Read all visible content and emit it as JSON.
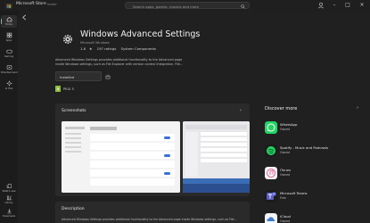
{
  "titlebar": {
    "title": "Microsoft Store",
    "badge": "Insider"
  },
  "search": {
    "placeholder": "Search apps, games, movies and more"
  },
  "sidebar": {
    "items": [
      {
        "label": "Home",
        "icon": "home-icon"
      },
      {
        "label": "Apps",
        "icon": "apps-icon"
      },
      {
        "label": "Gaming",
        "icon": "gaming-icon"
      },
      {
        "label": "Entertainment",
        "icon": "entertainment-icon"
      },
      {
        "label": "AI Hub",
        "icon": "ai-hub-icon"
      },
      {
        "label": "What's new",
        "icon": "whats-new-icon"
      },
      {
        "label": "Library",
        "icon": "library-icon"
      },
      {
        "label": "Downloads",
        "icon": "downloads-icon"
      }
    ]
  },
  "app": {
    "title": "Windows Advanced Settings",
    "publisher": "Microsoft Windows",
    "rating": "1.8",
    "ratings_count": "197 ratings",
    "category": "System Components",
    "description_line1": "Advanced Windows Settings provides additional functionality to the Advanced page",
    "description_line2": "inside Windows settings, such as File Explorer with version control integration. File...",
    "install_label": "Installed",
    "pegi": {
      "number": "3",
      "label": "PEGI 3"
    }
  },
  "screenshots": {
    "title": "Screenshots"
  },
  "description": {
    "title": "Description",
    "body": "Advanced Windows Settings provides additional functionality to the Advanced page inside Windows settings, such as File..."
  },
  "discover": {
    "title": "Discover more",
    "items": [
      {
        "name": "WhatsApp",
        "price": "Owned",
        "color": "#25d366"
      },
      {
        "name": "Spotify - Music and Podcasts",
        "price": "Owned",
        "color": "#1ed760"
      },
      {
        "name": "iTunes",
        "price": "Owned",
        "color": "#f5f5f5"
      },
      {
        "name": "Microsoft Teams",
        "price": "Free",
        "color": "#5b5fc7"
      },
      {
        "name": "iCloud",
        "price": "Owned",
        "color": "#3a7bd5"
      }
    ]
  },
  "colors": {
    "accent": "#4cc2ff",
    "background": "#202020",
    "card": "#2a2a2a"
  }
}
